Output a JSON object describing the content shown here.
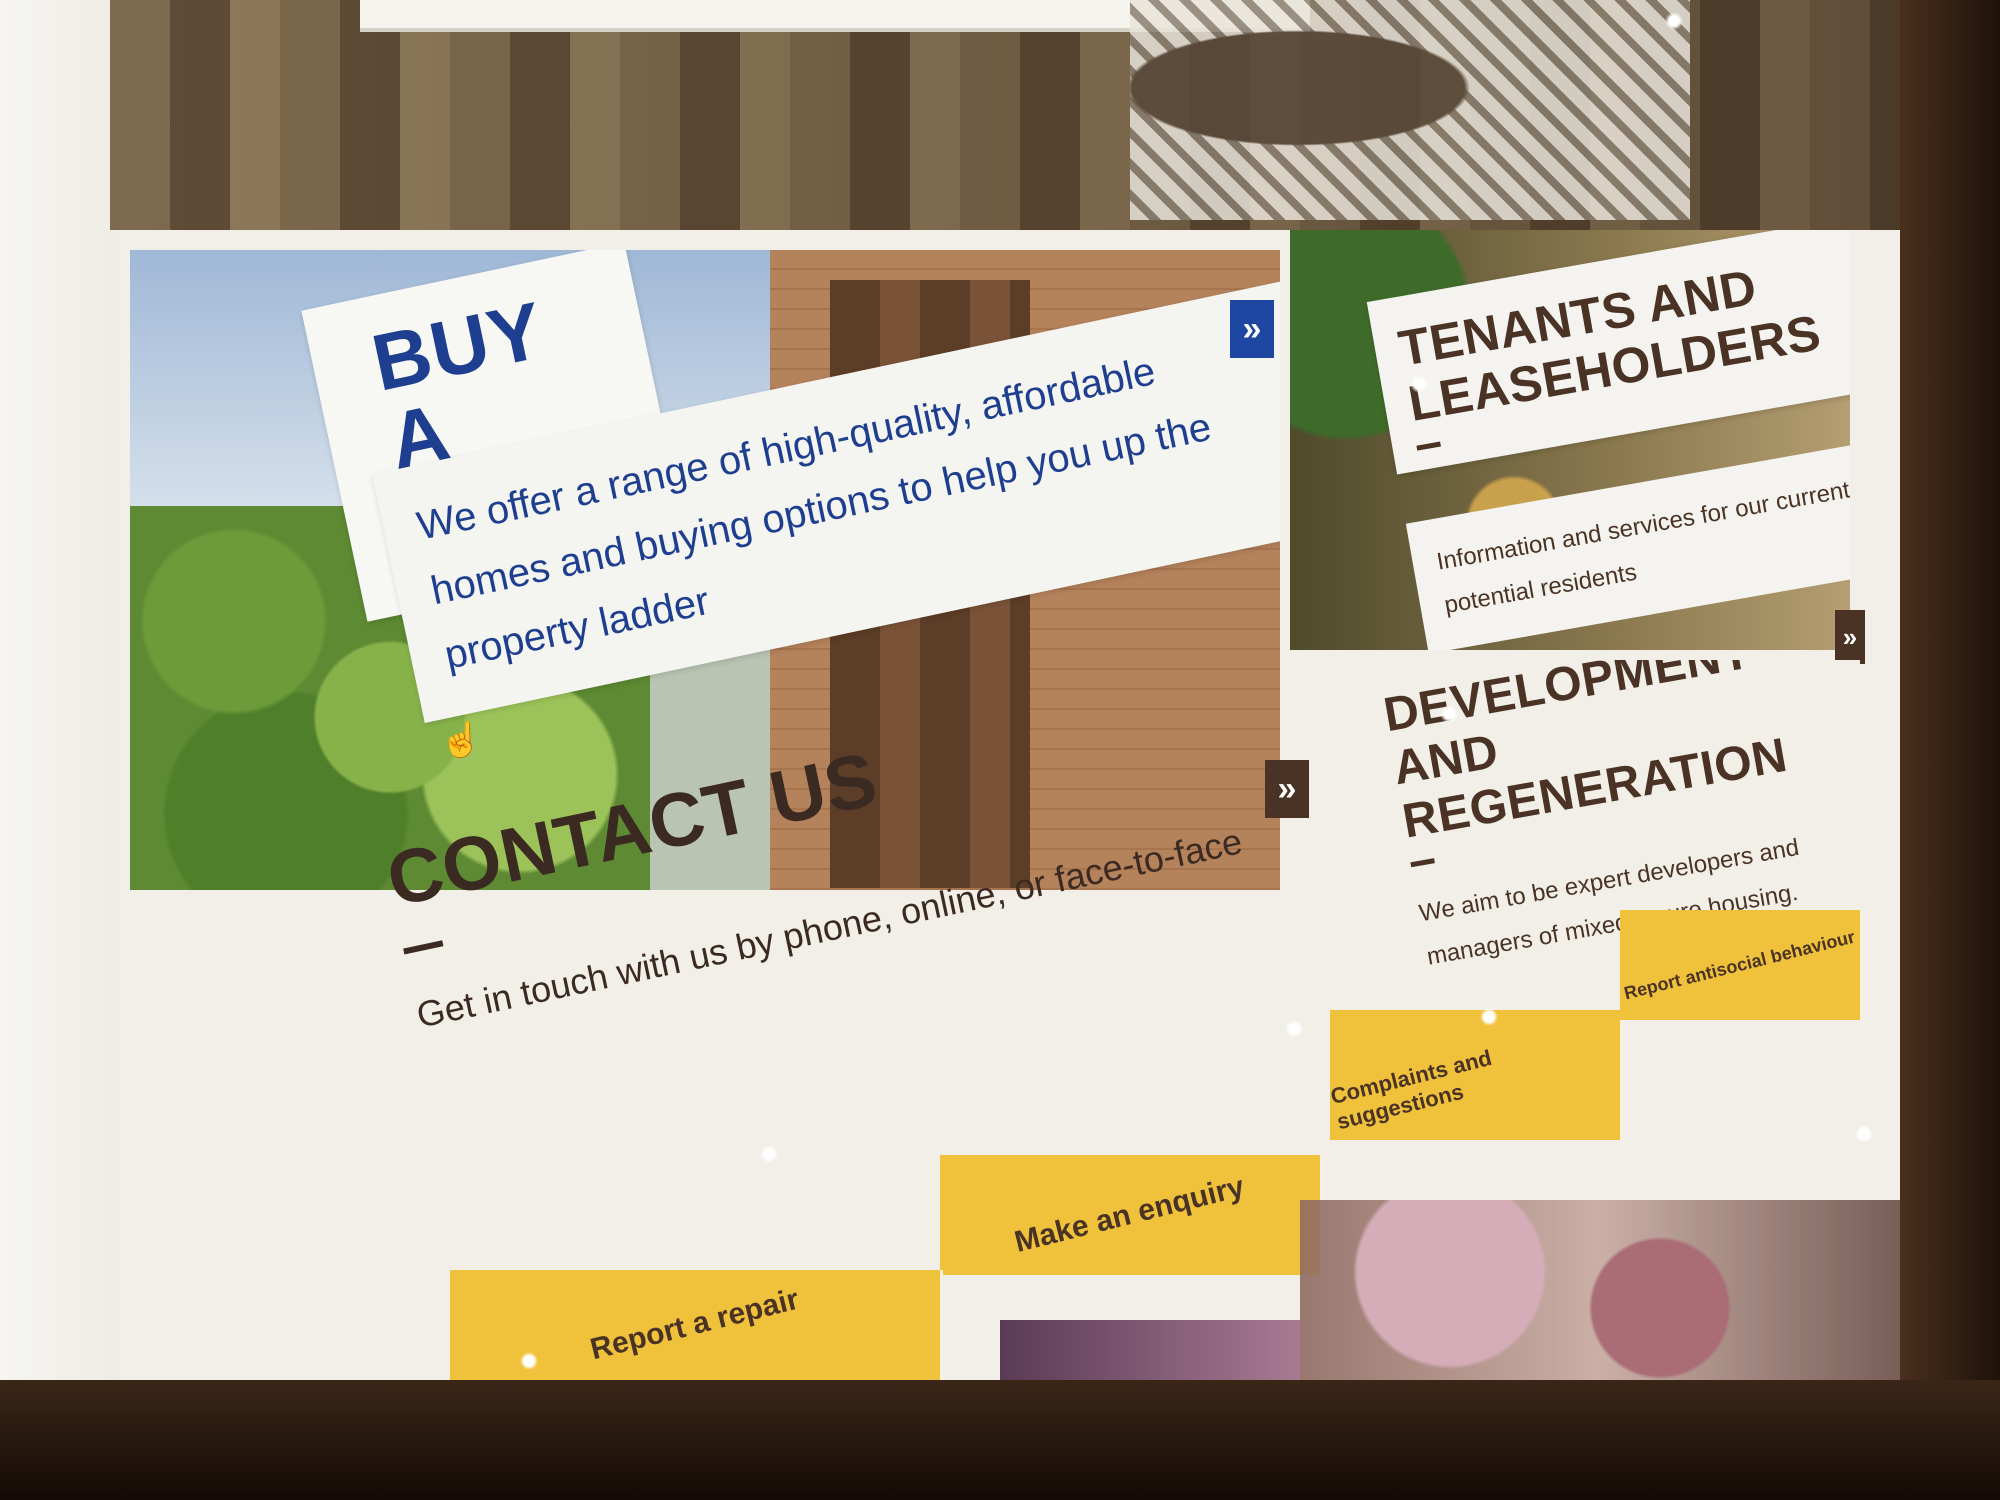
{
  "buy_home": {
    "title": "BUY A HOME",
    "description": "We offer a range of high-quality, affordable homes and buying options to help you up the property ladder",
    "arrow": "»"
  },
  "tenants": {
    "title": "TENANTS AND LEASEHOLDERS",
    "description": "Information and services for our current or potential residents",
    "arrow": "»"
  },
  "development": {
    "title": "DEVELOPMENT AND REGENERATION",
    "description": "We aim to be expert developers and managers of mixed tenure housing.",
    "arrow": "»"
  },
  "contact": {
    "title": "CONTACT US",
    "description": "Get in touch with us by phone, online, or face-to-face"
  },
  "quick_links": {
    "make_enquiry": "Make an enquiry",
    "report_repair": "Report a repair",
    "complaints": "Complaints and suggestions",
    "report_antisocial": "Report antisocial behaviour"
  },
  "colors": {
    "brand_blue": "#1e3e8f",
    "accent_yellow": "#f0c23b",
    "brand_dark": "#4a3324"
  }
}
